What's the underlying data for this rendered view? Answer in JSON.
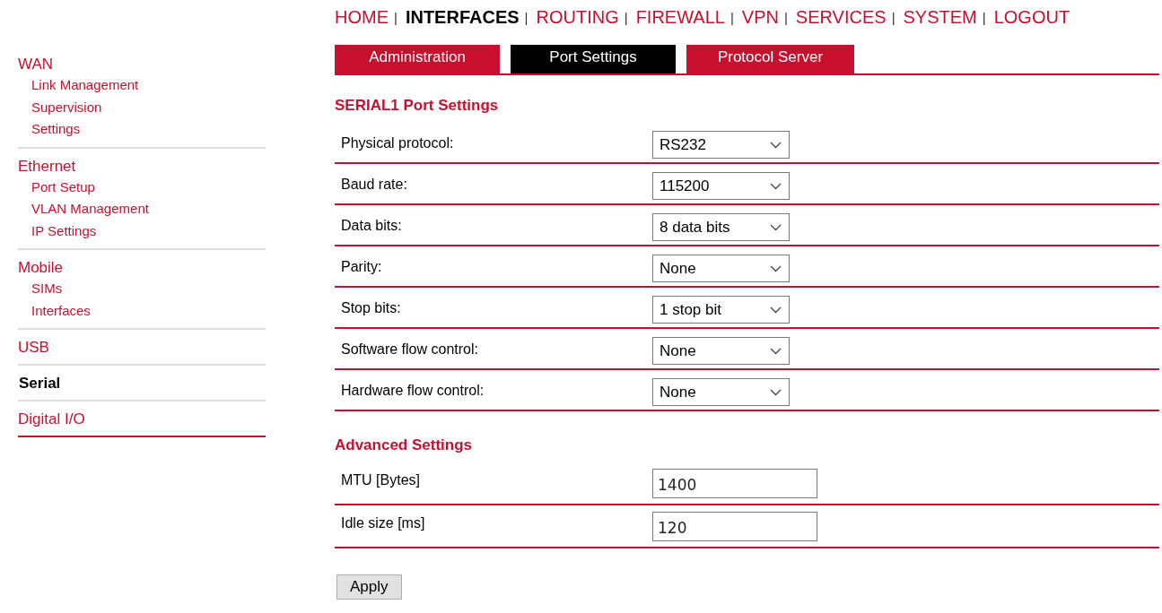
{
  "top_nav": [
    {
      "label": "HOME",
      "selected": false,
      "separator": "|"
    },
    {
      "label": "INTERFACES",
      "selected": true,
      "separator": "|"
    },
    {
      "label": "ROUTING",
      "selected": false,
      "separator": "|"
    },
    {
      "label": "FIREWALL",
      "selected": false,
      "separator": "|"
    },
    {
      "label": "VPN",
      "selected": false,
      "separator": "|"
    },
    {
      "label": "SERVICES",
      "selected": false,
      "separator": "|"
    },
    {
      "label": "SYSTEM",
      "selected": false,
      "separator": "|"
    },
    {
      "label": "LOGOUT",
      "selected": false
    }
  ],
  "sidebar": {
    "groups": [
      {
        "label": "WAN",
        "selected": false,
        "children": [
          {
            "label": "Link Management",
            "selected": false
          },
          {
            "label": "Supervision",
            "selected": false
          },
          {
            "label": "Settings",
            "selected": false
          }
        ]
      },
      {
        "label": "Ethernet",
        "selected": false,
        "children": [
          {
            "label": "Port Setup",
            "selected": false
          },
          {
            "label": "VLAN Management",
            "selected": false
          },
          {
            "label": "IP Settings",
            "selected": false
          }
        ]
      },
      {
        "label": "Mobile",
        "selected": false,
        "children": [
          {
            "label": "SIMs",
            "selected": false
          },
          {
            "label": "Interfaces",
            "selected": false
          }
        ]
      },
      {
        "label": "USB",
        "selected": false
      },
      {
        "label": "Serial",
        "selected": true
      },
      {
        "label": "Digital I/O",
        "selected": false
      }
    ]
  },
  "tabs": [
    {
      "label": "Administration",
      "selected": false
    },
    {
      "label": "Port Settings",
      "selected": true
    },
    {
      "label": "Protocol Server",
      "selected": false
    }
  ],
  "sections": [
    {
      "title": "SERIAL1 Port Settings",
      "rows": [
        {
          "label": "Physical protocol:",
          "kind": "select",
          "value": "RS232"
        },
        {
          "label": "Baud rate:",
          "kind": "select",
          "value": "115200"
        },
        {
          "label": "Data bits:",
          "kind": "select",
          "value": "8 data bits"
        },
        {
          "label": "Parity:",
          "kind": "select",
          "value": "None"
        },
        {
          "label": "Stop bits:",
          "kind": "select",
          "value": "1 stop bit"
        },
        {
          "label": "Software flow control:",
          "kind": "select",
          "value": "None"
        },
        {
          "label": "Hardware flow control:",
          "kind": "select",
          "value": "None"
        }
      ]
    },
    {
      "title": "Advanced Settings",
      "rows": [
        {
          "label": "MTU [Bytes]",
          "kind": "text",
          "value": "1400"
        },
        {
          "label": "Idle size [ms]",
          "kind": "text",
          "value": "120"
        }
      ]
    }
  ],
  "apply_button": "Apply"
}
